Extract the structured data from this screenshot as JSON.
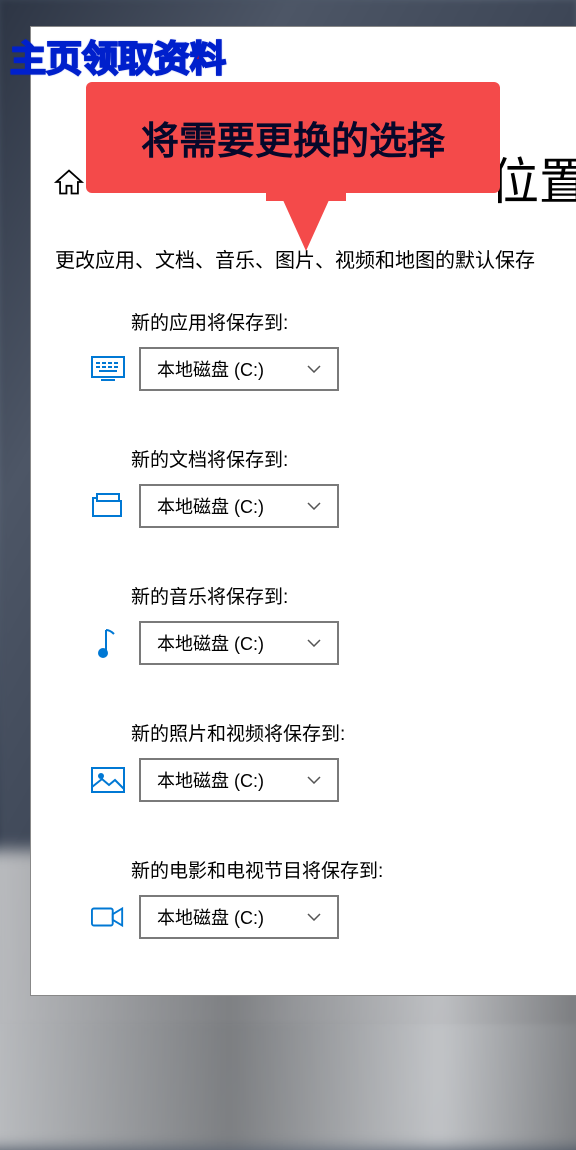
{
  "banner": {
    "text": "主页领取资料"
  },
  "callout": {
    "text": "将需要更换的选择"
  },
  "header": {
    "title": "位置"
  },
  "description": "更改应用、文档、音乐、图片、视频和地图的默认保存",
  "settings": [
    {
      "label": "新的应用将保存到:",
      "value": "本地磁盘 (C:)",
      "icon": "display"
    },
    {
      "label": "新的文档将保存到:",
      "value": "本地磁盘 (C:)",
      "icon": "folder"
    },
    {
      "label": "新的音乐将保存到:",
      "value": "本地磁盘 (C:)",
      "icon": "music"
    },
    {
      "label": "新的照片和视频将保存到:",
      "value": "本地磁盘 (C:)",
      "icon": "photo"
    },
    {
      "label": "新的电影和电视节目将保存到:",
      "value": "本地磁盘 (C:)",
      "icon": "video"
    }
  ]
}
